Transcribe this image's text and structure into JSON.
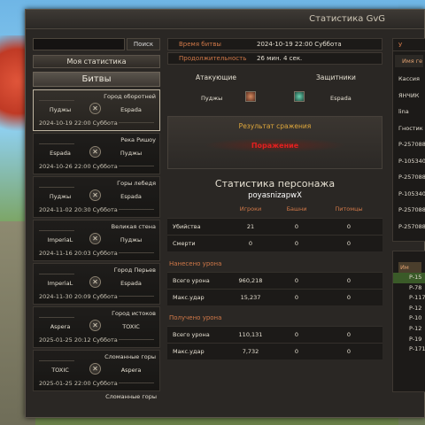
{
  "window": {
    "title": "Статистика GvG"
  },
  "left": {
    "search_placeholder": "",
    "search_button": "Поиск",
    "my_stats_button": "Моя статистика",
    "battles_header": "Битвы",
    "battles": [
      {
        "location": "Город оборотней",
        "team_a": "Пуджы",
        "team_b": "Espada",
        "date": "2024-10-19 22:00 Суббота",
        "selected": true
      },
      {
        "location": "Река Ришоу",
        "team_a": "Espada",
        "team_b": "Пуджы",
        "date": "2024-10-26 22:00 Суббота",
        "selected": false
      },
      {
        "location": "Горы лебедя",
        "team_a": "Пуджы",
        "team_b": "Espada",
        "date": "2024-11-02 20:30 Суббота",
        "selected": false
      },
      {
        "location": "Великая стена",
        "team_a": "ImperiaL",
        "team_b": "Пуджы",
        "date": "2024-11-16 20:03 Суббота",
        "selected": false
      },
      {
        "location": "Город Перьев",
        "team_a": "ImperiaL",
        "team_b": "Espada",
        "date": "2024-11-30 20:09 Суббота",
        "selected": false
      },
      {
        "location": "Город истоков",
        "team_a": "Aspera",
        "team_b": "TOXIC",
        "date": "2025-01-25 20:12 Суббота",
        "selected": false
      },
      {
        "location": "Сломанные горы",
        "team_a": "TOXIC",
        "team_b": "Aspera",
        "date": "2025-01-25 22:00 Суббота",
        "selected": false
      }
    ],
    "tail_location": "Сломанные горы"
  },
  "battle_info": {
    "time_label": "Время битвы",
    "time_value": "2024-10-19 22:00 Суббота",
    "duration_label": "Продолжительность",
    "duration_value": "26 мин. 4 сек.",
    "attackers_label": "Атакующие",
    "defenders_label": "Защитники",
    "attacker": "Пуджы",
    "defender": "Espada",
    "result_title": "Результат сражения",
    "result_value": "Поражение"
  },
  "char_stats": {
    "title": "Статистика персонажа",
    "name": "poyasnizapwX",
    "columns": [
      "Игроки",
      "Башни",
      "Питомцы"
    ],
    "rows": [
      {
        "label": "Убийства",
        "values": [
          "21",
          "0",
          "0"
        ]
      },
      {
        "label": "Смерти",
        "values": [
          "0",
          "0",
          "0"
        ]
      }
    ],
    "dealt_header": "Нанесено урона",
    "dealt_rows": [
      {
        "label": "Всего урона",
        "values": [
          "960,218",
          "0",
          "0"
        ]
      },
      {
        "label": "Макс.удар",
        "values": [
          "15,237",
          "0",
          "0"
        ]
      }
    ],
    "received_header": "Получено урона",
    "received_rows": [
      {
        "label": "Всего урона",
        "values": [
          "110,131",
          "0",
          "0"
        ]
      },
      {
        "label": "Макс.удар",
        "values": [
          "7,732",
          "0",
          "0"
        ]
      }
    ]
  },
  "right": {
    "header": "У",
    "subheader": "Имя ге",
    "items": [
      "Кассия",
      "ЯНЧИК",
      "lina",
      "Гностик",
      "P-257088",
      "P-105340",
      "P-257088",
      "P-105340",
      "P-257088",
      "P-257088"
    ],
    "panel2_header": "Им",
    "panel2_items": [
      "P-15",
      "P-78",
      "P-117",
      "P-12",
      "P-10",
      "P-12",
      "P-19",
      "P-171"
    ]
  },
  "colors": {
    "accent_orange": "#d07848",
    "result_red": "#e02020",
    "result_gold": "#e0a83c"
  }
}
